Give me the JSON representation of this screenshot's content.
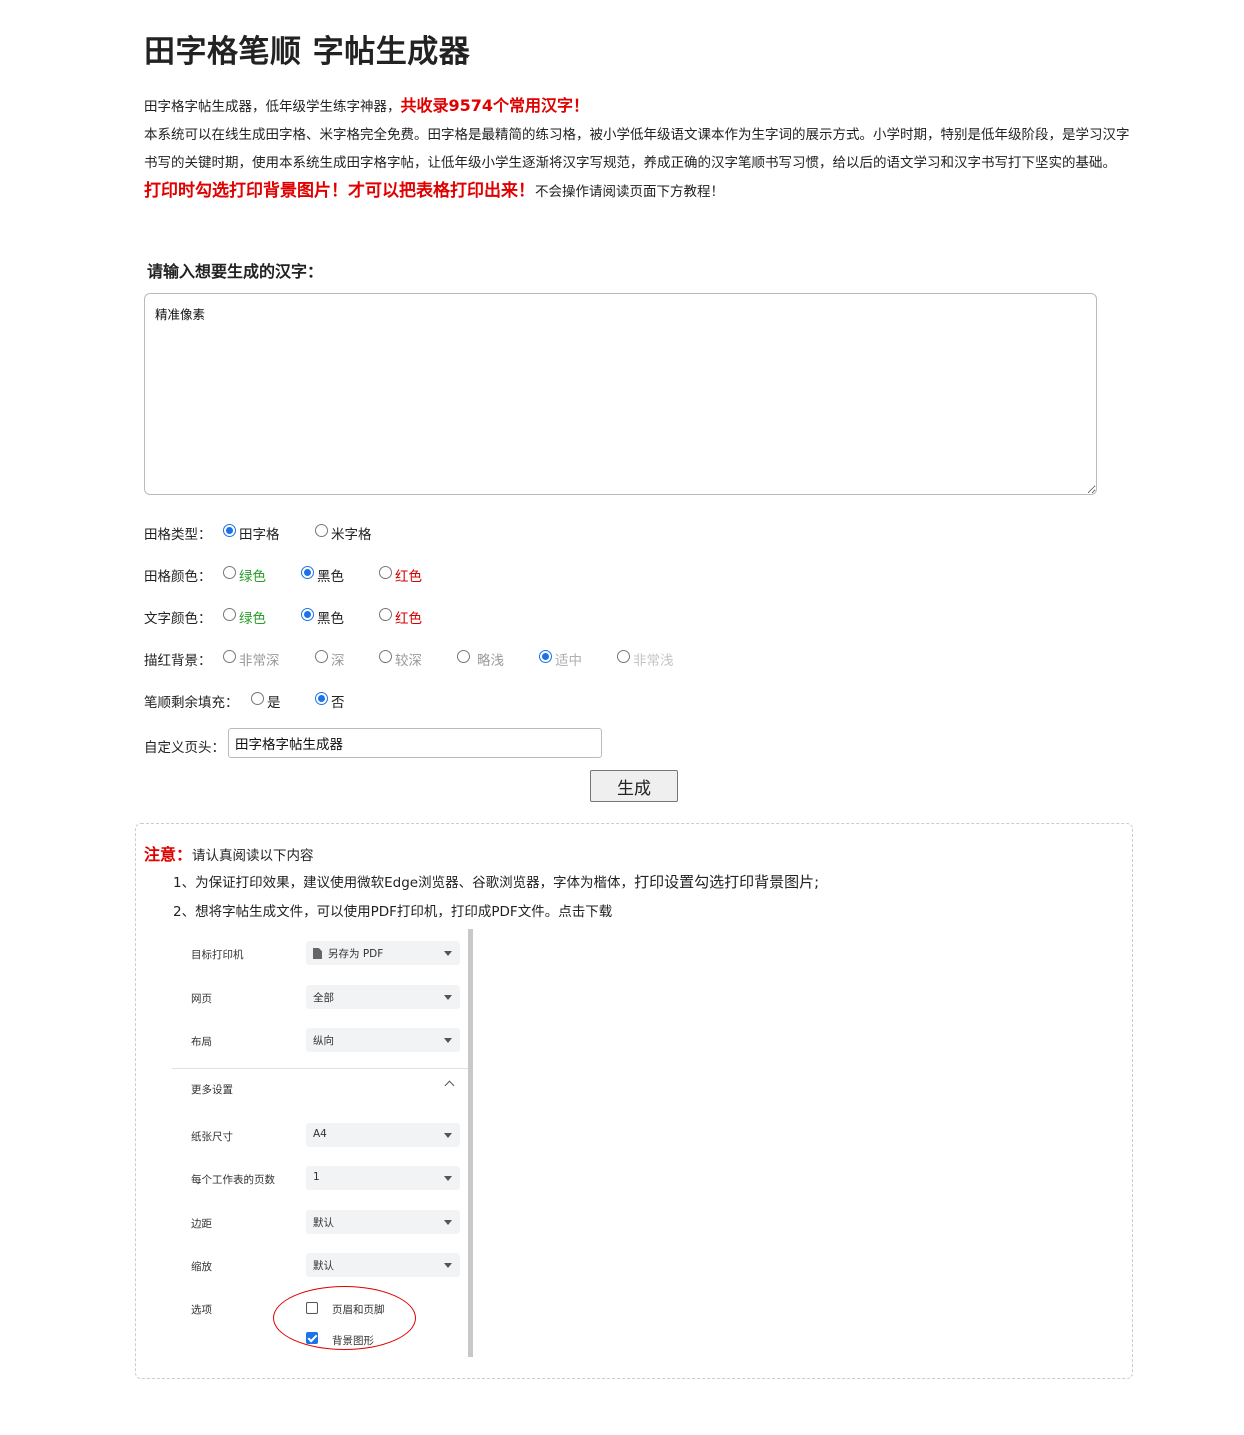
{
  "page": {
    "title": "田字格笔顺 字帖生成器",
    "intro_line1_a": "田字格字帖生成器，低年级学生练字神器，",
    "intro_line1_red": "共收录9574个常用汉字！",
    "intro_para": "本系统可以在线生成田字格、米字格完全免费。田字格是最精简的练习格，被小学低年级语文课本作为生字词的展示方式。小学时期，特别是低年级阶段，是学习汉字书写的关键时期，使用本系统生成田字格字帖，让低年级小学生逐渐将汉字写规范，养成正确的汉字笔顺书写习惯，给以后的语文学习和汉字书写打下坚实的基础。",
    "warn_red": "打印时勾选打印背景图片！才可以把表格打印出来！",
    "warn_tail": "不会操作请阅读页面下方教程！"
  },
  "form": {
    "input_prompt": "请输入想要生成的汉字：",
    "textarea_value": "精准像素",
    "grid_type": {
      "label": "田格类型：",
      "options": [
        "田字格",
        "米字格"
      ],
      "selected": "田字格"
    },
    "grid_color": {
      "label": "田格颜色：",
      "options": [
        "绿色",
        "黑色",
        "红色"
      ],
      "selected": "黑色"
    },
    "text_color": {
      "label": "文字颜色：",
      "options": [
        "绿色",
        "黑色",
        "红色"
      ],
      "selected": "黑色"
    },
    "trace_bg": {
      "label": "描红背景：",
      "options": [
        "非常深",
        "深",
        "较深",
        "略浅",
        "适中",
        "非常浅"
      ],
      "selected": "适中"
    },
    "stroke_fill": {
      "label": "笔顺剩余填充：",
      "options": [
        "是",
        "否"
      ],
      "selected": "否"
    },
    "custom_header": {
      "label": "自定义页头：",
      "value": "田字格字帖生成器"
    },
    "generate_label": "生成"
  },
  "notice": {
    "title": "注意：",
    "subtitle": "请认真阅读以下内容",
    "item1_a": "1、为保证打印效果，建议使用微软Edge浏览器、谷歌浏览器，字体为楷体，",
    "item1_b": "打印设置勾选打印背景图片;",
    "item2": "2、想将字帖生成文件，可以使用PDF打印机，打印成PDF文件。点击下载"
  },
  "print_dialog": {
    "rows": [
      {
        "label": "目标打印机",
        "value": "另存为 PDF"
      },
      {
        "label": "网页",
        "value": "全部"
      },
      {
        "label": "布局",
        "value": "纵向"
      }
    ],
    "more_settings": "更多设置",
    "more_rows": [
      {
        "label": "纸张尺寸",
        "value": "A4"
      },
      {
        "label": "每个工作表的页数",
        "value": "1"
      },
      {
        "label": "边距",
        "value": "默认"
      },
      {
        "label": "缩放",
        "value": "默认"
      }
    ],
    "options_label": "选项",
    "checkbox_header_footer": "页眉和页脚",
    "checkbox_background": "背景图形"
  }
}
